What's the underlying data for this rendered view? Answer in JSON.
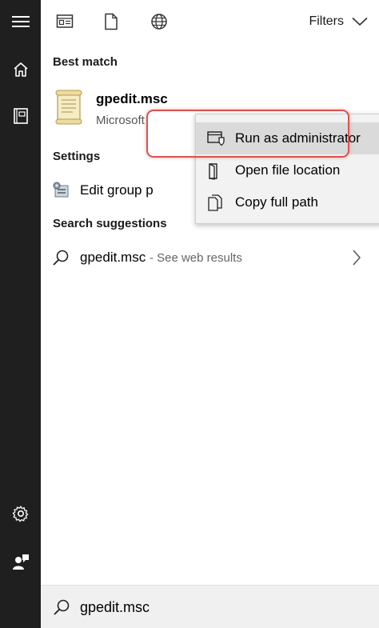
{
  "topbar": {
    "filters_label": "Filters",
    "icons": [
      "apps-icon",
      "documents-icon",
      "web-icon"
    ]
  },
  "rail": {
    "icons": [
      "hamburger-menu-icon",
      "home-icon",
      "notebook-icon",
      "settings-gear-icon",
      "feedback-icon"
    ]
  },
  "sections": {
    "best_match": "Best match",
    "settings": "Settings",
    "search_suggestions": "Search suggestions"
  },
  "best_match_item": {
    "title": "gpedit.msc",
    "subtitle": "Microsoft"
  },
  "settings_item": {
    "label": "Edit group p"
  },
  "suggestion": {
    "term": "gpedit.msc",
    "hint": "- See web results"
  },
  "context_menu": {
    "items": [
      {
        "label": "Run as administrator",
        "icon": "shield-window-icon",
        "highlighted": true
      },
      {
        "label": "Open file location",
        "icon": "folder-open-icon",
        "highlighted": false
      },
      {
        "label": "Copy full path",
        "icon": "copy-icon",
        "highlighted": false
      }
    ]
  },
  "search": {
    "value": "gpedit.msc"
  },
  "colors": {
    "rail_bg": "#1f1f1f",
    "highlight_ring": "#d9534f",
    "menu_bg": "#f2f2f2",
    "menu_hover": "#dadada",
    "search_bg": "#f0f0f0"
  }
}
